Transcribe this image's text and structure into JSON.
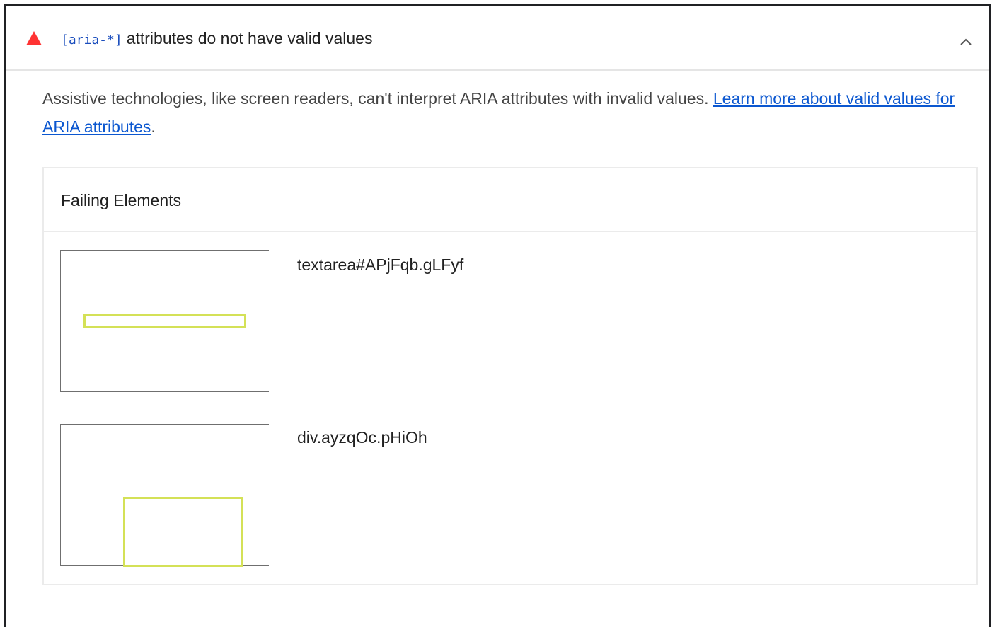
{
  "audit": {
    "status_icon": "warning-triangle-icon",
    "status_color": "#f33",
    "title_code": "[aria-*]",
    "title_text": "attributes do not have valid values",
    "toggle_icon": "chevron-up-icon"
  },
  "description": {
    "text": "Assistive technologies, like screen readers, can't interpret ARIA attributes with invalid values. ",
    "link_text": "Learn more about valid values for ARIA attributes",
    "trailing": "."
  },
  "table": {
    "header": "Failing Elements",
    "rows": [
      {
        "selector": "textarea#APjFqb.gLFyf"
      },
      {
        "selector": "div.ayzqOc.pHiOh"
      }
    ]
  },
  "colors": {
    "link": "#0b57d0",
    "code": "#1a4dbd",
    "highlight": "#d4e157",
    "fail": "#ff3333"
  }
}
